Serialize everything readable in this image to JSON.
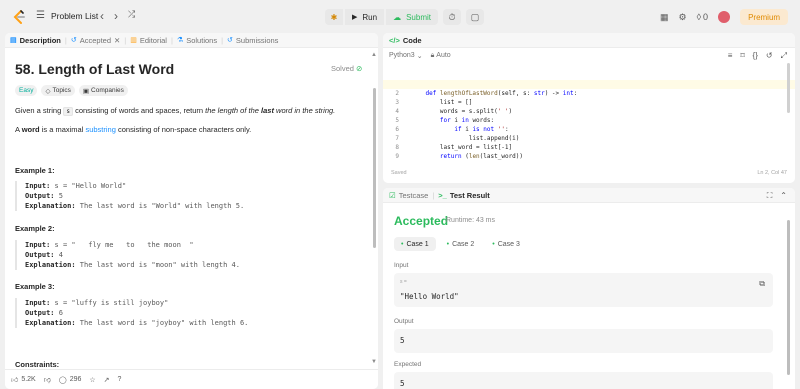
{
  "nav": {
    "problem_list": "Problem List",
    "run": "Run",
    "submit": "Submit",
    "coins": "0",
    "premium": "Premium"
  },
  "left_tabs": [
    "Description",
    "Accepted",
    "Editorial",
    "Solutions",
    "Submissions"
  ],
  "problem": {
    "title": "58. Length of Last Word",
    "status": "Solved",
    "tags": [
      "Easy",
      "Topics",
      "Companies"
    ],
    "desc1_a": "Given a string ",
    "desc1_code": "s",
    "desc1_b": " consisting of words and spaces, return ",
    "desc1_c": "the length of the ",
    "desc1_d": "last",
    "desc1_e": " word in the string.",
    "desc2_a": "A ",
    "desc2_b": "word",
    "desc2_c": " is a maximal ",
    "desc2_d": "substring",
    "desc2_e": " consisting of non-space characters only."
  },
  "examples": [
    {
      "title": "Example 1:",
      "input_label": "Input:",
      "input": " s = \"Hello World\"",
      "output_label": "Output:",
      "output": " 5",
      "expl_label": "Explanation:",
      "expl": " The last word is \"World\" with length 5."
    },
    {
      "title": "Example 2:",
      "input_label": "Input:",
      "input": " s = \"   fly me   to   the moon  \"",
      "output_label": "Output:",
      "output": " 4",
      "expl_label": "Explanation:",
      "expl": " The last word is \"moon\" with length 4."
    },
    {
      "title": "Example 3:",
      "input_label": "Input:",
      "input": " s = \"luffy is still joyboy\"",
      "output_label": "Output:",
      "output": " 6",
      "expl_label": "Explanation:",
      "expl": " The last word is \"joyboy\" with length 6."
    }
  ],
  "constraints": "Constraints:",
  "left_footer": {
    "likes": "5.2K",
    "comments": "296"
  },
  "code_panel": {
    "title": "Code",
    "language": "Python3",
    "auto": "Auto",
    "saved": "Saved",
    "cursor": "Ln 2, Col 47",
    "lines": [
      "1",
      "2",
      "3",
      "4",
      "5",
      "6",
      "7",
      "8",
      "9"
    ]
  },
  "test_panel": {
    "testcase_tab": "Testcase",
    "result_tab": "Test Result",
    "accepted": "Accepted",
    "runtime": "Runtime: 43 ms",
    "cases": [
      "Case 1",
      "Case 2",
      "Case 3"
    ],
    "input_label": "Input",
    "input_var": "s =",
    "input_value": "\"Hello World\"",
    "output_label": "Output",
    "output_value": "5",
    "expected_label": "Expected",
    "expected_value": "5"
  },
  "icons": [
    "leetcode-logo",
    "list-icon",
    "chevron-left-icon",
    "chevron-right-icon",
    "shuffle-icon",
    "bug-icon",
    "play-icon",
    "cloud-upload-icon",
    "timer-icon",
    "notes-icon",
    "grid-icon",
    "gear-icon",
    "fire-icon",
    "avatar-icon"
  ]
}
